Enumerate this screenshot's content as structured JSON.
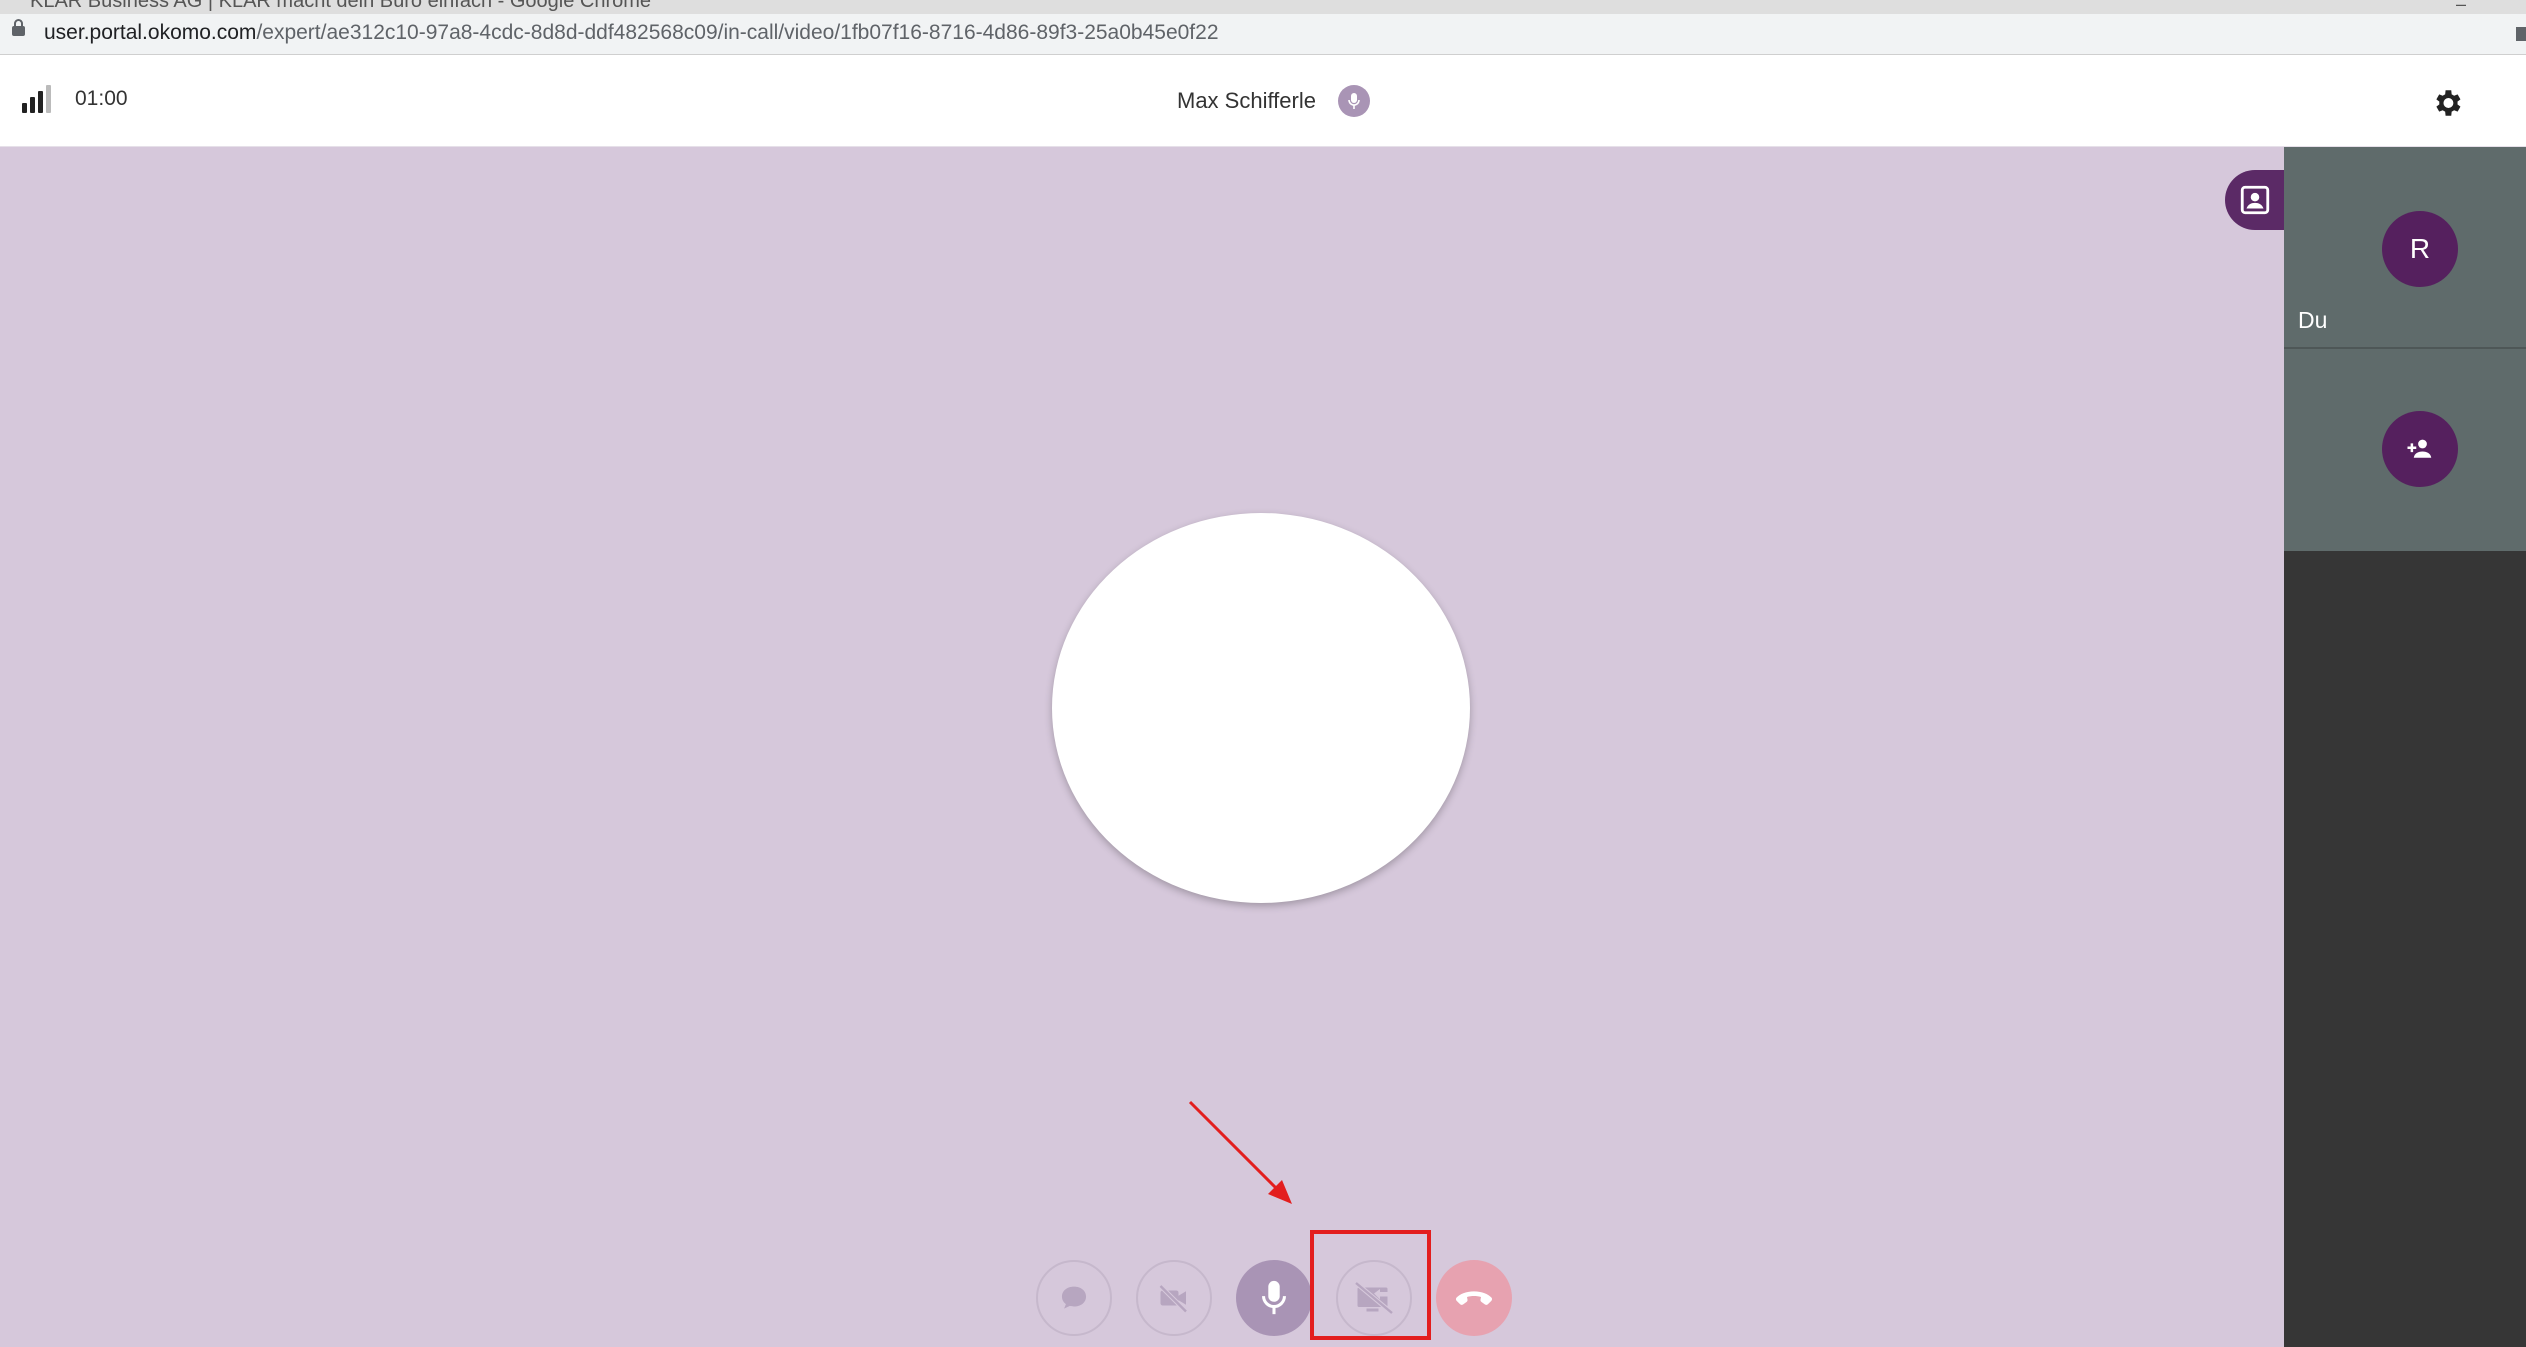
{
  "browser": {
    "window_title": "KLAR Business AG | KLAR macht dein Büro einfach - Google Chrome",
    "url_host": "user.portal.okomo.com",
    "url_path": "/expert/ae312c10-97a8-4cdc-8d8d-ddf482568c09/in-call/video/1fb07f16-8716-4d86-89f3-25a0b45e0f22"
  },
  "header": {
    "timer": "01:00",
    "caller_name": "Max Schifferle",
    "icons": [
      "signal-strength-icon",
      "microphone-icon",
      "gear-icon"
    ]
  },
  "side_panel": {
    "self_initial": "R",
    "self_label": "Du",
    "icons": [
      "add-person-icon"
    ]
  },
  "controls": {
    "buttons": [
      "chat-icon",
      "video-off-icon",
      "microphone-icon",
      "screen-share-off-icon",
      "hang-up-icon"
    ]
  },
  "colors": {
    "stage_background": "#d6c8db",
    "brand_purple": "#55205e",
    "tile_background": "#5f6b6b",
    "hangup": "#e7a2b0",
    "annotation_red": "#e31e1e"
  }
}
